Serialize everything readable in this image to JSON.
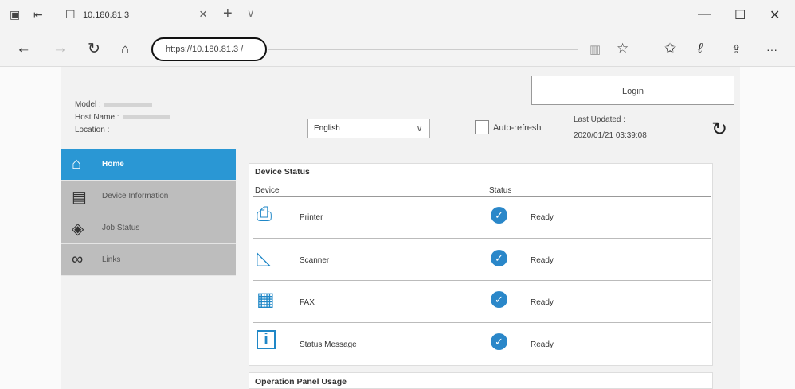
{
  "browser": {
    "tab_title": "10.180.81.3",
    "tab_close": "×",
    "new_tab": "+",
    "tab_chevron": "∨",
    "address_url": "https://10.180.81.3 /",
    "win_min": "—",
    "win_max": "☐",
    "win_close": "✕",
    "more": "···"
  },
  "header": {
    "model_label": "Model :",
    "host_label": "Host Name :",
    "location_label": "Location :",
    "language": "English",
    "auto_refresh_label": "Auto-refresh",
    "login_label": "Login",
    "last_updated_label": "Last Updated :",
    "last_updated_value": "2020/01/21 03:39:08"
  },
  "sidebar": {
    "items": [
      {
        "label": "Home",
        "icon": "home-icon",
        "active": true
      },
      {
        "label": "Device Information",
        "icon": "device-info-icon",
        "active": false
      },
      {
        "label": "Job Status",
        "icon": "eye-icon",
        "active": false
      },
      {
        "label": "Links",
        "icon": "link-icon",
        "active": false
      }
    ]
  },
  "device_status": {
    "title": "Device Status",
    "col_device": "Device",
    "col_status": "Status",
    "rows": [
      {
        "device": "Printer",
        "status": "Ready.",
        "icon": "printer-icon"
      },
      {
        "device": "Scanner",
        "status": "Ready.",
        "icon": "scanner-icon"
      },
      {
        "device": "FAX",
        "status": "Ready.",
        "icon": "fax-icon"
      },
      {
        "device": "Status Message",
        "status": "Ready.",
        "icon": "info-icon"
      }
    ]
  },
  "operation_panel": {
    "title": "Operation Panel Usage"
  },
  "colors": {
    "accent": "#2a97d4",
    "sidebar_bg": "#bdbdbd",
    "status_ok": "#2a87c9"
  }
}
